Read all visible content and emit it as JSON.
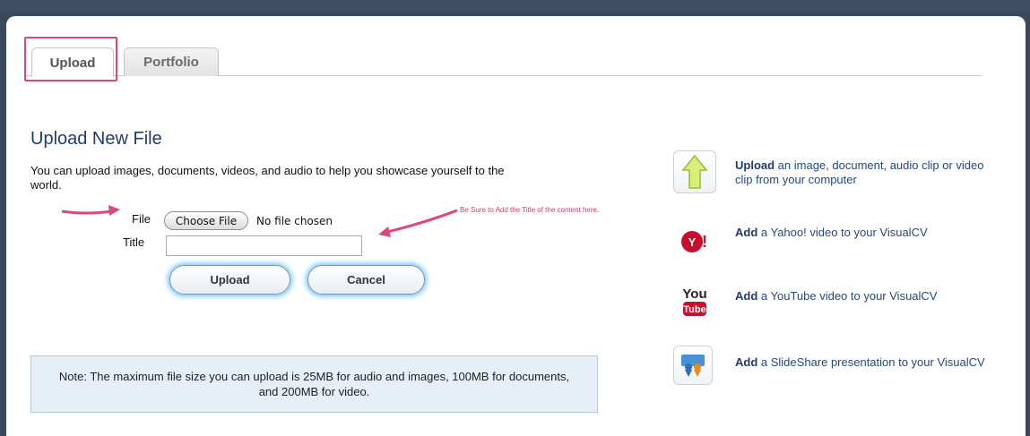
{
  "tabs": [
    {
      "label": "Upload",
      "active": true
    },
    {
      "label": "Portfolio",
      "active": false
    }
  ],
  "form": {
    "title": "Upload New File",
    "intro": "You can upload images, documents, videos, and audio to help you showcase yourself to the world.",
    "file_label": "File",
    "choose_file_label": "Choose File",
    "no_file_text": "No file chosen",
    "title_label": "Title",
    "title_value": "",
    "upload_button": "Upload",
    "cancel_button": "Cancel"
  },
  "annotation": "Be Sure to Add the Title of the content here.",
  "note": "Note: The maximum file size you can upload is 25MB for audio and images, 100MB for documents, and 200MB for video.",
  "side_options": [
    {
      "icon": "upload-arrow-icon",
      "action": "Upload",
      "text": " an image, document, audio clip or video clip from your computer"
    },
    {
      "icon": "yahoo-icon",
      "action": "Add",
      "text": " a Yahoo! video to your VisualCV"
    },
    {
      "icon": "youtube-icon",
      "action": "Add",
      "text": " a YouTube video to your VisualCV"
    },
    {
      "icon": "slideshare-icon",
      "action": "Add",
      "text": " a SlideShare presentation to your VisualCV"
    }
  ],
  "colors": {
    "accent_pink": "#e0457f",
    "heading_blue": "#1f3c6e",
    "button_glow": "#6cc6ff",
    "note_bg": "#e6eef7"
  }
}
